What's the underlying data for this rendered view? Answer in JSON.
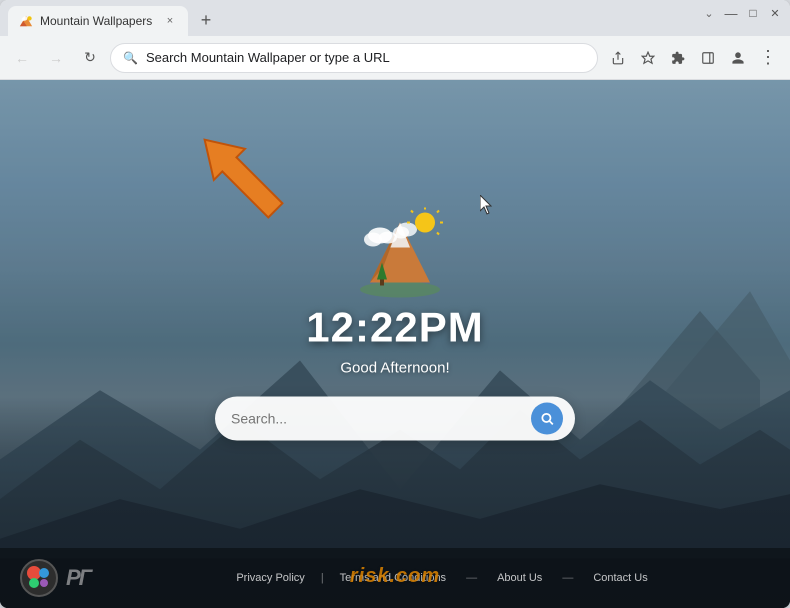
{
  "browser": {
    "tab": {
      "favicon_alt": "mountain-wallpapers-favicon",
      "title": "Mountain Wallpapers",
      "close_label": "×"
    },
    "new_tab_label": "+",
    "window_controls": {
      "minimize": "—",
      "maximize": "□",
      "close": "✕"
    },
    "toolbar": {
      "back_label": "←",
      "forward_label": "→",
      "refresh_label": "↻",
      "address_placeholder": "Search Mountain Wallpaper or type a URL",
      "address_value": "Search Mountain Wallpaper or type a URL",
      "share_icon": "⬆",
      "bookmark_icon": "☆",
      "extensions_icon": "🧩",
      "sidebar_icon": "▥",
      "profile_icon": "👤",
      "menu_icon": "⋮"
    }
  },
  "page": {
    "clock": {
      "time": "12:22PM",
      "greeting": "Good Afternoon!"
    },
    "search": {
      "placeholder": "Search...",
      "button_icon": "🔍"
    },
    "footer": {
      "logo_text": "ΡΓ",
      "links": [
        {
          "label": "Privacy Policy"
        },
        {
          "label": "Terms and Conditions"
        },
        {
          "label": "About Us"
        },
        {
          "label": "Contact Us"
        }
      ],
      "separator": "—"
    },
    "watermark": "risk.com",
    "arrow_tooltip": "Points to address bar"
  }
}
